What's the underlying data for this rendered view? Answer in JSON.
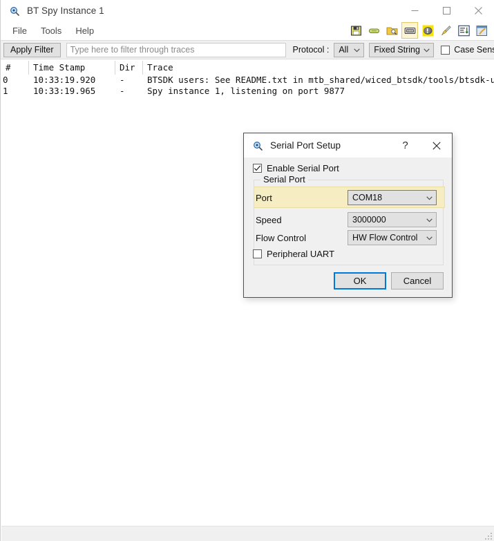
{
  "window": {
    "title": "BT Spy Instance 1",
    "icon": "magnifier-icon",
    "minimize_label": "Minimize",
    "maximize_label": "Maximize",
    "close_label": "Close"
  },
  "menu": {
    "items": [
      {
        "label": "File",
        "name": "menu-file"
      },
      {
        "label": "Tools",
        "name": "menu-tools"
      },
      {
        "label": "Help",
        "name": "menu-help"
      }
    ]
  },
  "toolbar": {
    "buttons": [
      {
        "icon": "save-icon",
        "selected": false
      },
      {
        "icon": "capsule-icon",
        "selected": false
      },
      {
        "icon": "open-folder-icon",
        "selected": false
      },
      {
        "icon": "serial-port-icon",
        "selected": true
      },
      {
        "icon": "alert-icon",
        "selected": false
      },
      {
        "icon": "clear-brush-icon",
        "selected": false
      },
      {
        "icon": "sort-list-icon",
        "selected": false
      },
      {
        "icon": "script-window-icon",
        "selected": false
      }
    ]
  },
  "filterbar": {
    "apply_filter_label": "Apply Filter",
    "filter_value": "",
    "filter_placeholder": "Type here to filter through traces",
    "protocol_label": "Protocol :",
    "protocol_value": "All",
    "match_mode_value": "Fixed String",
    "case_sensitive_label": "Case Sensitive",
    "case_sensitive_checked": false
  },
  "trace": {
    "columns": [
      "#",
      "Time Stamp",
      "Dir",
      "Trace"
    ],
    "rows": [
      {
        "num": "0",
        "time": "10:33:19.920",
        "dir": "-",
        "text": "BTSDK users: See README.txt in mtb_shared/wiced_btsdk/tools/btsdk-util…"
      },
      {
        "num": "1",
        "time": "10:33:19.965",
        "dir": "-",
        "text": "Spy instance 1, listening on port 9877"
      }
    ]
  },
  "statusbar": {
    "text": "",
    "grip_name": "resize-grip"
  },
  "dialog": {
    "title": "Serial Port Setup",
    "icon": "magnifier-icon",
    "help_label": "?",
    "close_label": "✕",
    "enable_serial_port": {
      "label": "Enable Serial Port",
      "checked": true
    },
    "group_caption": "Serial Port",
    "fields": [
      {
        "label": "Port",
        "value": "COM18",
        "highlighted": true
      },
      {
        "label": "Speed",
        "value": "3000000",
        "highlighted": false
      },
      {
        "label": "Flow Control",
        "value": "HW Flow Control",
        "highlighted": false
      }
    ],
    "peripheral_uart": {
      "label": "Peripheral UART",
      "checked": false
    },
    "ok_label": "OK",
    "cancel_label": "Cancel"
  },
  "colors": {
    "highlight_band": "#f6eec2",
    "focus_blue": "#0078d7",
    "toolbar_selected": "#fdf4d2",
    "chrome": "#f0f0f0"
  }
}
